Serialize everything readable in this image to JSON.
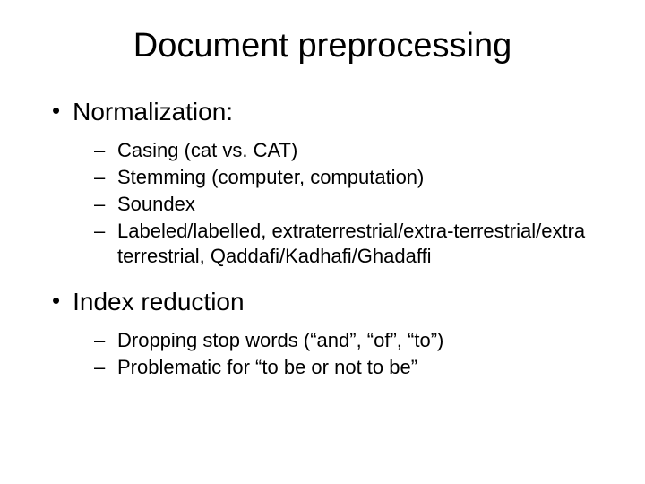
{
  "title": "Document preprocessing",
  "sections": [
    {
      "label": "Normalization:",
      "items": [
        "Casing (cat vs. CAT)",
        "Stemming (computer, computation)",
        "Soundex",
        "Labeled/labelled, extraterrestrial/extra-terrestrial/extra terrestrial, Qaddafi/Kadhafi/Ghadaffi"
      ]
    },
    {
      "label": "Index reduction",
      "items": [
        "Dropping stop words (“and”, “of”, “to”)",
        "Problematic for “to be or not to be”"
      ]
    }
  ],
  "markers": {
    "l1": "•",
    "l2": "–"
  }
}
